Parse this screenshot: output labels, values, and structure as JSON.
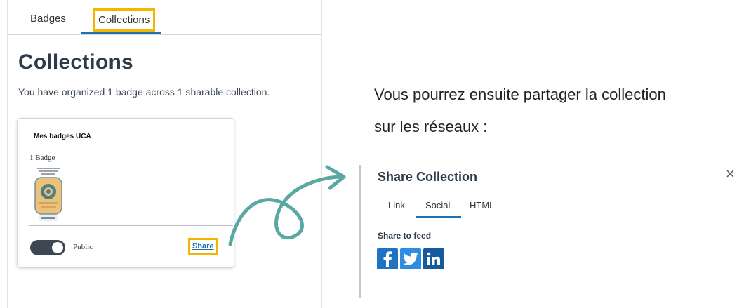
{
  "tabs": {
    "badges": "Badges",
    "collections": "Collections"
  },
  "page": {
    "title": "Collections",
    "summary": "You have organized 1 badge across 1 sharable collection."
  },
  "collection_card": {
    "name": "Mes badges UCA",
    "badge_count": "1 Badge",
    "visibility_label": "Public",
    "visibility_on": true,
    "share_label": "Share"
  },
  "instruction": {
    "line1": "Vous pourrez ensuite partager la collection",
    "line2": "sur les réseaux :"
  },
  "share_modal": {
    "title": "Share Collection",
    "close_symbol": "×",
    "tabs": [
      "Link",
      "Social",
      "HTML"
    ],
    "active_tab": "Social",
    "feed_label": "Share to feed",
    "networks": [
      "facebook",
      "twitter",
      "linkedin"
    ]
  },
  "colors": {
    "highlight": "#f4b400",
    "accent": "#1f6fb2",
    "arrow": "#5aa7a3",
    "facebook": "#1f73c2",
    "twitter": "#2f8de0",
    "linkedin": "#145a9c"
  }
}
